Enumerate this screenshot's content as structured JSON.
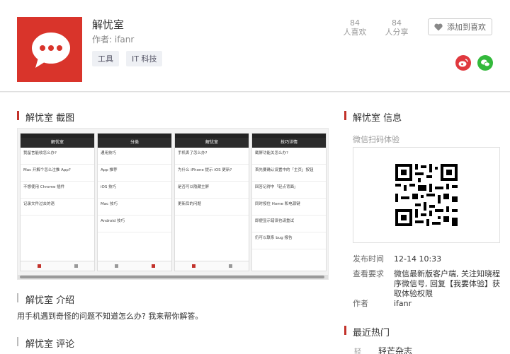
{
  "app": {
    "title": "解忧室",
    "author": "作者: ifanr",
    "tags": [
      "工具",
      "IT 科技"
    ],
    "likes_count": "84",
    "likes_label": "人喜欢",
    "shares_count": "84",
    "shares_label": "人分享",
    "favorite_label": "添加到喜欢"
  },
  "sections": {
    "screenshots_title": "解忧室 截图",
    "intro_title": "解忧室 介绍",
    "intro_text": "用手机遇到奇怪的问题不知道怎么办? 我来帮你解答。",
    "comments_title": "解忧室 评论",
    "info_title": "解忧室 信息",
    "hot_title": "最近热门"
  },
  "screenshots": [
    {
      "nav": "解忧室",
      "rows": [
        "我留言能收怎么办?",
        "Mac 开解个怎么注推 App?",
        "不想使用 Chrome 插件",
        "记录文件过去的语"
      ]
    },
    {
      "nav": "分类",
      "rows": [
        "通用技巧",
        "App 推荐",
        "iOS 技巧",
        "Mac 技巧",
        "Android 技巧"
      ]
    },
    {
      "nav": "解忧室",
      "rows": [
        "手机丢了怎么办?",
        "为什么 iPhone 提示 iOS 更新?",
        "是否可以隐藏主屏",
        "更新后的问题"
      ]
    },
    {
      "nav": "技巧详情",
      "rows": [
        "截屏功能关怎么办?",
        "首先要确认设置中的「主页」按钮",
        "回答记得中「轻点背面」",
        "同时按住 Home 和电源键",
        "即便显示错误也请重试",
        "仍可以联系 bug 报告"
      ]
    }
  ],
  "info": {
    "scan_label": "微信扫码体验",
    "publish_label": "发布时间",
    "publish_value": "12-14 10:33",
    "require_label": "查看要求",
    "require_value": "微信最新版客户端, 关注知晓程序微信号, 回复【我要体验】获取体验权限",
    "author_label": "作者",
    "author_value": "ifanr"
  },
  "hot": {
    "icon_label": "轻",
    "first_item": "轻芒杂志"
  },
  "colors": {
    "accent": "#c2322b",
    "weibo": "#e0383e",
    "wechat": "#33b93b"
  }
}
